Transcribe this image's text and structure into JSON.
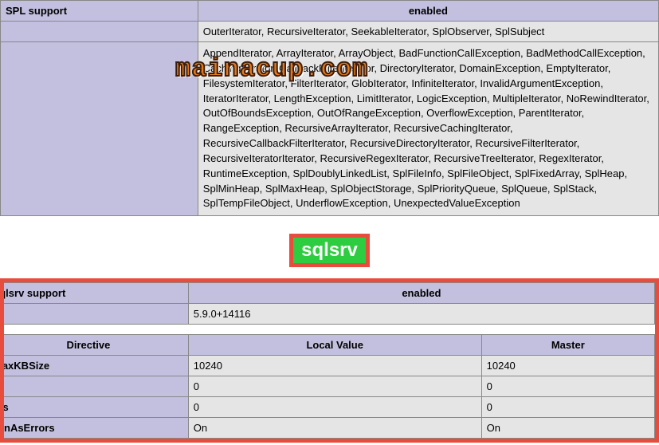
{
  "watermark": "mainacup.com",
  "spl": {
    "header": {
      "label": "SPL support",
      "status": "enabled"
    },
    "interfaces": "OuterIterator, RecursiveIterator, SeekableIterator, SplObserver, SplSubject",
    "classes": "AppendIterator, ArrayIterator, ArrayObject, BadFunctionCallException, BadMethodCallException, CachingIterator, CallbackFilterIterator, DirectoryIterator, DomainException, EmptyIterator, FilesystemIterator, FilterIterator, GlobIterator, InfiniteIterator, InvalidArgumentException, IteratorIterator, LengthException, LimitIterator, LogicException, MultipleIterator, NoRewindIterator, OutOfBoundsException, OutOfRangeException, OverflowException, ParentIterator, RangeException, RecursiveArrayIterator, RecursiveCachingIterator, RecursiveCallbackFilterIterator, RecursiveDirectoryIterator, RecursiveFilterIterator, RecursiveIteratorIterator, RecursiveRegexIterator, RecursiveTreeIterator, RegexIterator, RuntimeException, SplDoublyLinkedList, SplFileInfo, SplFileObject, SplFixedArray, SplHeap, SplMinHeap, SplMaxHeap, SplObjectStorage, SplPriorityQueue, SplQueue, SplStack, SplTempFileObject, UnderflowException, UnexpectedValueException"
  },
  "sqlsrv": {
    "title": "sqlsrv",
    "support": {
      "label": "sqlsrv support",
      "status": "enabled"
    },
    "version": "5.9.0+14116",
    "directive_header": {
      "directive": "Directive",
      "local": "Local Value",
      "master": "Master"
    },
    "rows": [
      {
        "name": "MaxKBSize",
        "local": "10240",
        "master": "10240"
      },
      {
        "name": "",
        "local": "0",
        "master": "0"
      },
      {
        "name": "ms",
        "local": "0",
        "master": "0"
      },
      {
        "name": "urnAsErrors",
        "local": "On",
        "master": "On"
      }
    ]
  }
}
